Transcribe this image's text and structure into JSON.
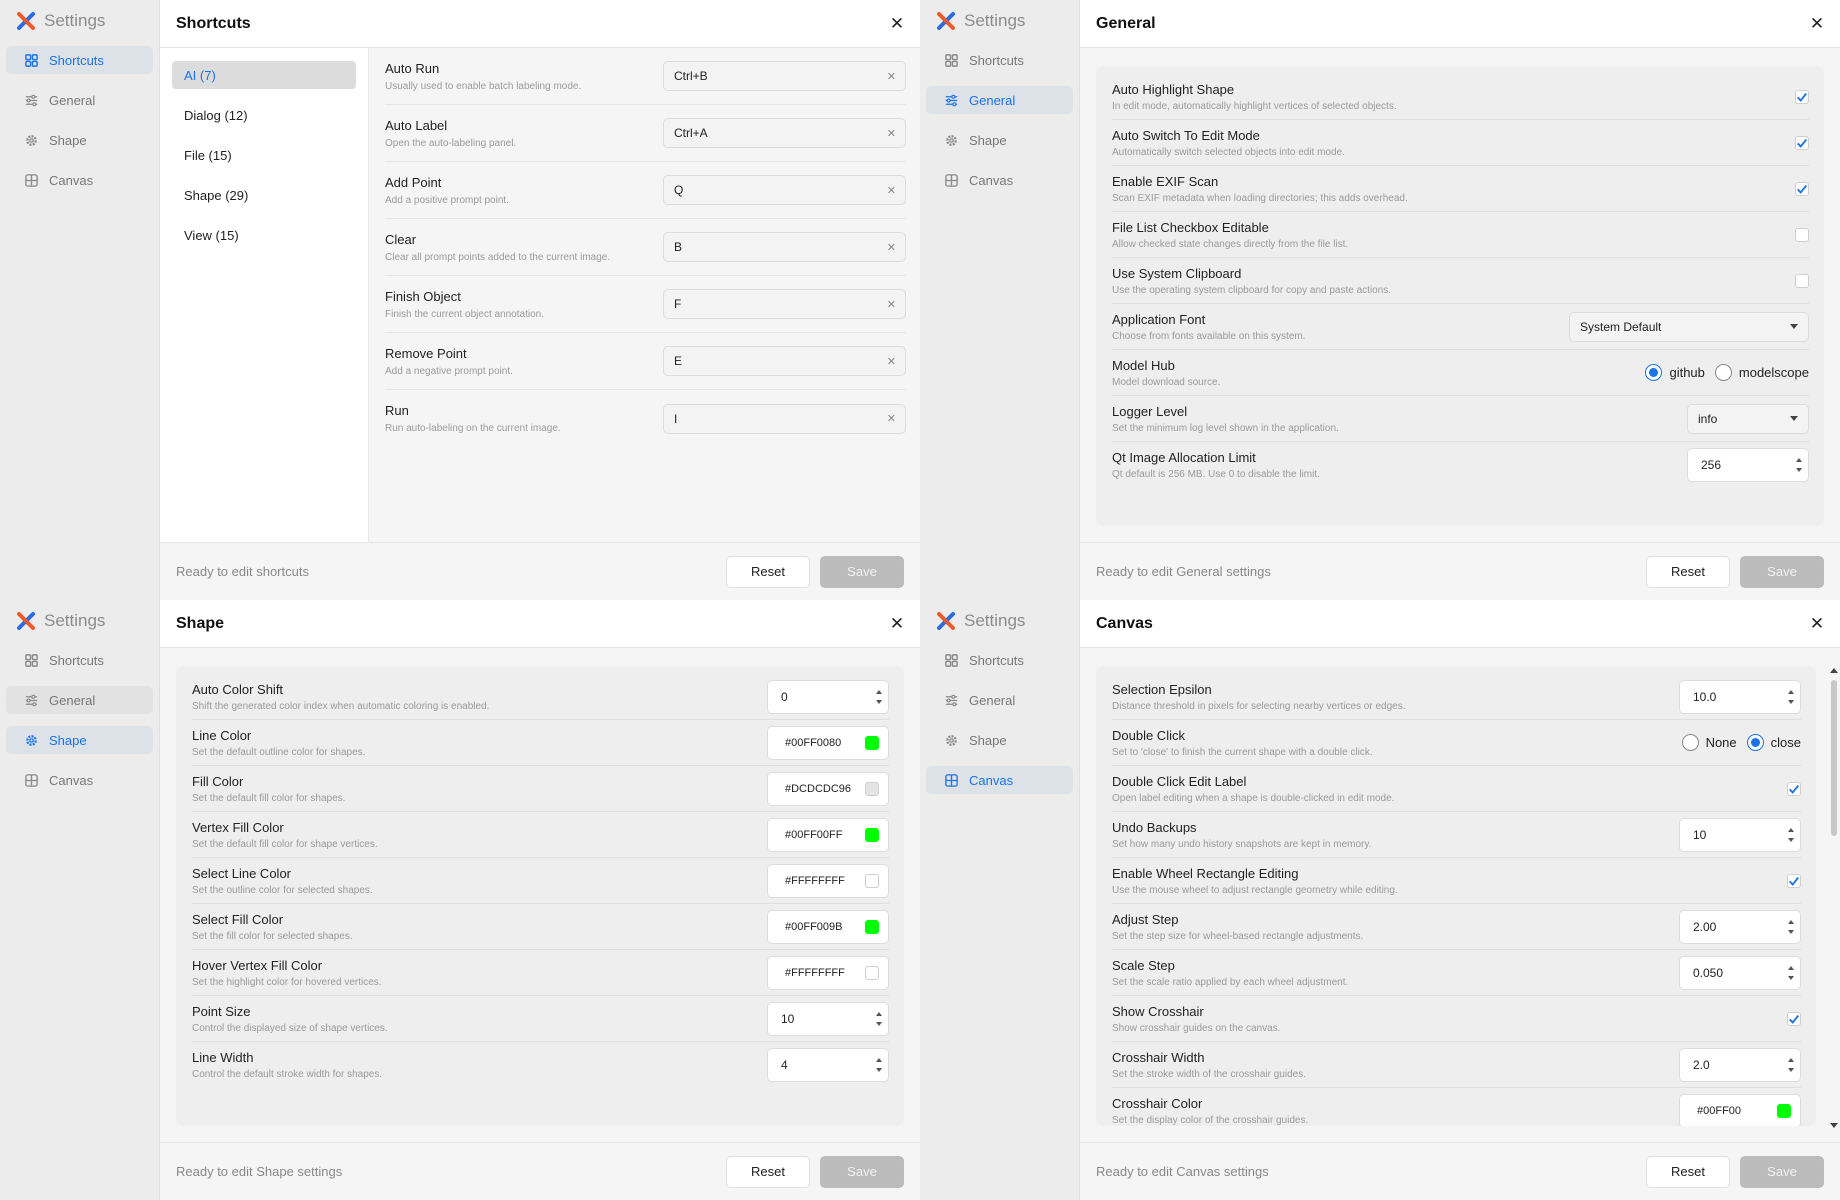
{
  "brand": "Settings",
  "nav": [
    "Shortcuts",
    "General",
    "Shape",
    "Canvas"
  ],
  "buttons": {
    "reset": "Reset",
    "save": "Save"
  },
  "colors": {
    "accent": "#1a73e8",
    "logo_orange": "#f05a28",
    "logo_blue": "#2d6cdf"
  },
  "shortcuts": {
    "title": "Shortcuts",
    "categories": [
      "AI (7)",
      "Dialog (12)",
      "File (15)",
      "Shape (29)",
      "View (15)"
    ],
    "items": [
      {
        "name": "Auto Run",
        "desc": "Usually used to enable batch labeling mode.",
        "key": "Ctrl+B"
      },
      {
        "name": "Auto Label",
        "desc": "Open the auto-labeling panel.",
        "key": "Ctrl+A"
      },
      {
        "name": "Add Point",
        "desc": "Add a positive prompt point.",
        "key": "Q"
      },
      {
        "name": "Clear",
        "desc": "Clear all prompt points added to the current image.",
        "key": "B"
      },
      {
        "name": "Finish Object",
        "desc": "Finish the current object annotation.",
        "key": "F"
      },
      {
        "name": "Remove Point",
        "desc": "Add a negative prompt point.",
        "key": "E"
      },
      {
        "name": "Run",
        "desc": "Run auto-labeling on the current image.",
        "key": "I"
      }
    ],
    "status": "Ready to edit shortcuts"
  },
  "general": {
    "title": "General",
    "rows": [
      {
        "name": "Auto Highlight Shape",
        "desc": "In edit mode, automatically highlight vertices of selected objects.",
        "checked": true
      },
      {
        "name": "Auto Switch To Edit Mode",
        "desc": "Automatically switch selected objects into edit mode.",
        "checked": true
      },
      {
        "name": "Enable EXIF Scan",
        "desc": "Scan EXIF metadata when loading directories; this adds overhead.",
        "checked": true
      },
      {
        "name": "File List Checkbox Editable",
        "desc": "Allow checked state changes directly from the file list.",
        "checked": false
      },
      {
        "name": "Use System Clipboard",
        "desc": "Use the operating system clipboard for copy and paste actions.",
        "checked": false
      },
      {
        "name": "Application Font",
        "desc": "Choose from fonts available on this system.",
        "select": "System Default"
      },
      {
        "name": "Model Hub",
        "desc": "Model download source.",
        "radios": [
          "github",
          "modelscope"
        ],
        "selected": "github"
      },
      {
        "name": "Logger Level",
        "desc": "Set the minimum log level shown in the application.",
        "select": "info"
      },
      {
        "name": "Qt Image Allocation Limit",
        "desc": "Qt default is 256 MB. Use 0 to disable the limit.",
        "spin": "256"
      }
    ],
    "status": "Ready to edit General settings"
  },
  "shape": {
    "title": "Shape",
    "rows": [
      {
        "name": "Auto Color Shift",
        "desc": "Shift the generated color index when automatic coloring is enabled.",
        "spin": "0"
      },
      {
        "name": "Line Color",
        "desc": "Set the default outline color for shapes.",
        "color": "#00FF0080",
        "swatch": "#00ff00"
      },
      {
        "name": "Fill Color",
        "desc": "Set the default fill color for shapes.",
        "color": "#DCDCDC96",
        "swatch": "#e4e4e4"
      },
      {
        "name": "Vertex Fill Color",
        "desc": "Set the default fill color for shape vertices.",
        "color": "#00FF00FF",
        "swatch": "#00ff00"
      },
      {
        "name": "Select Line Color",
        "desc": "Set the outline color for selected shapes.",
        "color": "#FFFFFFFF",
        "swatch": "#ffffff"
      },
      {
        "name": "Select Fill Color",
        "desc": "Set the fill color for selected shapes.",
        "color": "#00FF009B",
        "swatch": "#00ff00"
      },
      {
        "name": "Hover Vertex Fill Color",
        "desc": "Set the highlight color for hovered vertices.",
        "color": "#FFFFFFFF",
        "swatch": "#ffffff"
      },
      {
        "name": "Point Size",
        "desc": "Control the displayed size of shape vertices.",
        "spin": "10"
      },
      {
        "name": "Line Width",
        "desc": "Control the default stroke width for shapes.",
        "spin": "4"
      }
    ],
    "status": "Ready to edit Shape settings"
  },
  "canvas": {
    "title": "Canvas",
    "rows": [
      {
        "name": "Selection Epsilon",
        "desc": "Distance threshold in pixels for selecting nearby vertices or edges.",
        "spin": "10.0"
      },
      {
        "name": "Double Click",
        "desc": "Set to 'close' to finish the current shape with a double click.",
        "radios": [
          "None",
          "close"
        ],
        "selected": "close"
      },
      {
        "name": "Double Click Edit Label",
        "desc": "Open label editing when a shape is double-clicked in edit mode.",
        "checked": true
      },
      {
        "name": "Undo Backups",
        "desc": "Set how many undo history snapshots are kept in memory.",
        "spin": "10"
      },
      {
        "name": "Enable Wheel Rectangle Editing",
        "desc": "Use the mouse wheel to adjust rectangle geometry while editing.",
        "checked": true
      },
      {
        "name": "Adjust Step",
        "desc": "Set the step size for wheel-based rectangle adjustments.",
        "spin": "2.00"
      },
      {
        "name": "Scale Step",
        "desc": "Set the scale ratio applied by each wheel adjustment.",
        "spin": "0.050"
      },
      {
        "name": "Show Crosshair",
        "desc": "Show crosshair guides on the canvas.",
        "checked": true
      },
      {
        "name": "Crosshair Width",
        "desc": "Set the stroke width of the crosshair guides.",
        "spin": "2.0"
      },
      {
        "name": "Crosshair Color",
        "desc": "Set the display color of the crosshair guides.",
        "color": "#00FF00",
        "swatch": "#00ff00"
      }
    ],
    "status": "Ready to edit Canvas settings"
  }
}
